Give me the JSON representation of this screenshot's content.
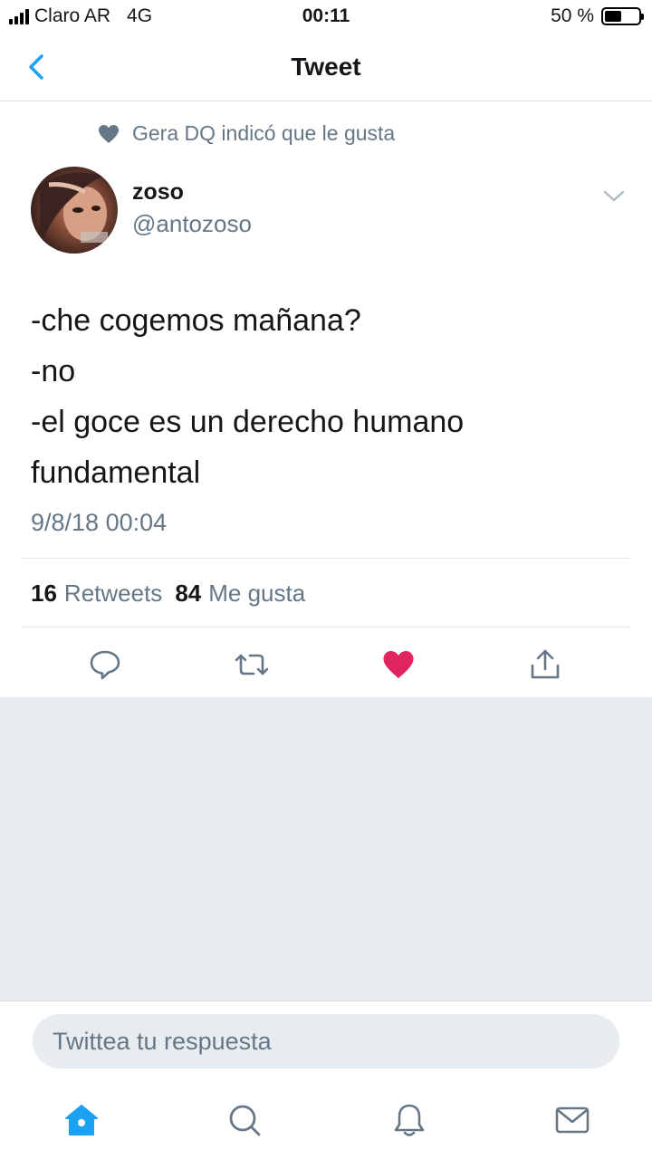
{
  "status_bar": {
    "carrier": "Claro AR",
    "network": "4G",
    "time": "00:11",
    "battery": "50 %",
    "battery_level": 0.5
  },
  "nav": {
    "title": "Tweet"
  },
  "tweet": {
    "social_context": "Gera DQ indicó que le gusta",
    "display_name": "zoso",
    "handle": "@antozoso",
    "text_lines": [
      "-che cogemos mañana?",
      "-no",
      "-el goce es un derecho humano",
      "fundamental"
    ],
    "timestamp": "9/8/18 00:04",
    "retweets_count": "16",
    "retweets_label": "Retweets",
    "likes_count": "84",
    "likes_label": "Me gusta",
    "liked": true
  },
  "reply": {
    "placeholder": "Twittea tu respuesta"
  },
  "colors": {
    "accent": "#1da1f2",
    "like": "#e0245e",
    "secondary_text": "#657786",
    "background_gray": "#e6ecf0"
  },
  "icons": {
    "back": "chevron-left-icon",
    "caret": "chevron-down-icon",
    "reply": "reply-icon",
    "retweet": "retweet-icon",
    "like": "heart-icon",
    "share": "share-icon",
    "home": "home-icon",
    "search": "search-icon",
    "notifications": "bell-icon",
    "messages": "mail-icon"
  }
}
